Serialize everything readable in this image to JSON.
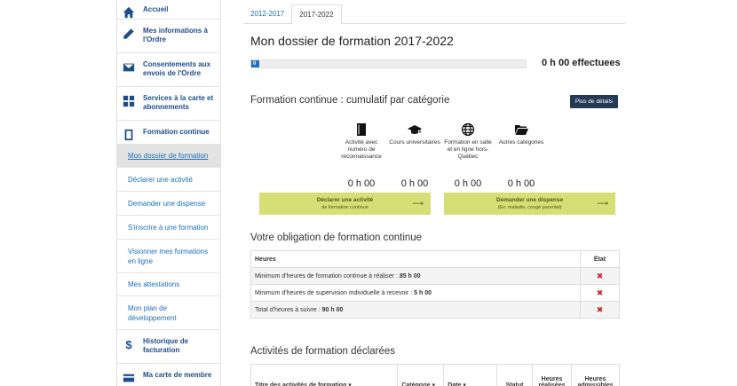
{
  "sidebar": {
    "main_items": [
      {
        "label": "Accueil",
        "icon": "home-icon"
      },
      {
        "label": "Mes informations à l'Ordre",
        "icon": "pencil-icon"
      },
      {
        "label": "Consentements aux envois de l'Ordre",
        "icon": "envelope-icon"
      },
      {
        "label": "Services à la carte et abonnements",
        "icon": "grid-icon"
      },
      {
        "label": "Formation continue",
        "icon": "book-icon"
      }
    ],
    "sub_items": [
      {
        "label": "Mon dossier de formation"
      },
      {
        "label": "Déclarer une activité"
      },
      {
        "label": "Demander une dispense"
      },
      {
        "label": "S'inscrire à une formation"
      },
      {
        "label": "Visionner mes formations en ligne"
      },
      {
        "label": "Mes attestations"
      },
      {
        "label": "Mon plan de développement"
      }
    ],
    "bottom_items": [
      {
        "label": "Historique de facturation",
        "icon": "dollar-icon"
      },
      {
        "label": "Ma carte de membre",
        "icon": "card-icon"
      }
    ]
  },
  "tabs": [
    {
      "label": "2012-2017"
    },
    {
      "label": "2017-2022"
    }
  ],
  "page_title": "Mon dossier de formation 2017-2022",
  "progress": {
    "label": "0 %",
    "value": 0.03
  },
  "effectuees": "0 h 00 effectuees",
  "cumul": {
    "title": "Formation continue : cumulatif par catégorie",
    "details_button": "Plus de détails",
    "categories": [
      {
        "label": "Activité avec numéro de reconnaissance",
        "value": "0 h 00",
        "icon": "book-icon"
      },
      {
        "label": "Cours universitaires",
        "value": "0 h 00",
        "icon": "graduation-cap-icon"
      },
      {
        "label": "Formation en salle et en ligne hors-Québec",
        "value": "0 h 00",
        "icon": "globe-icon"
      },
      {
        "label": "Autres catégories",
        "value": "0 h 00",
        "icon": "folder-open-icon"
      }
    ],
    "declare_button": {
      "line1": "Déclarer une activité",
      "line2": "de formation continue"
    },
    "dispense_button": {
      "line1": "Demander une dispense",
      "line2": "(Ex: maladie, congé parental)"
    }
  },
  "obligation": {
    "title": "Votre obligation de formation continue",
    "headers": {
      "heures": "Heures",
      "etat": "État"
    },
    "rows": [
      {
        "text": "Minimum d'heures de formation continue à réaliser : ",
        "value": "85 h 00"
      },
      {
        "text": "Minimum d'heures de supervision individuelle à recevoir : ",
        "value": "5 h 00"
      },
      {
        "text": "Total d'heures à suivre : ",
        "value": "90 h 00"
      }
    ],
    "state_mark": "✖"
  },
  "activites": {
    "title": "Activités de formation déclarées",
    "headers": {
      "titre": "Titre des activités de formation ▾",
      "categorie": "Catégorie ▾",
      "date": "Date ▾",
      "statut": "Statut",
      "realisees": "Heures réalisées",
      "admissibles": "Heures admissibles"
    }
  },
  "colors": {
    "brand": "#1e4d8c",
    "link": "#1e6fb8",
    "action": "#d6df75",
    "dark_button": "#233b54",
    "error": "#c0282d"
  }
}
